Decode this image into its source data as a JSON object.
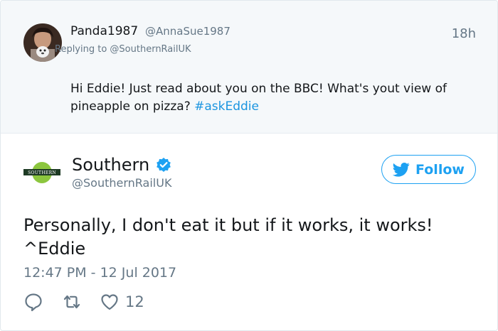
{
  "parent_tweet": {
    "display_name": "Panda1987",
    "handle": "@AnnaSue1987",
    "time_ago": "18h",
    "replying_to": "Replying to @SouthernRailUK",
    "text_main": "Hi Eddie! Just read about you on the BBC! What's yout view of pineapple on pizza? ",
    "hashtag": "#askEddie"
  },
  "tweet": {
    "display_name": "Southern",
    "handle": "@SouthernRailUK",
    "logo_text": "SOUTHERN",
    "follow_label": "Follow",
    "text": "Personally, I don't eat it but if it works, it works! ^Eddie",
    "timestamp": "12:47 PM - 12 Jul 2017",
    "likes": "12"
  },
  "colors": {
    "accent": "#1da1f2",
    "hashtag": "#1b95e0",
    "muted": "#657786",
    "parent_bg": "#f5f8fa",
    "southern_green": "#8cc63e",
    "southern_dark": "#1e3a24"
  },
  "icons": {
    "reply": "reply-icon",
    "retweet": "retweet-icon",
    "like": "heart-icon",
    "verified": "verified-badge-icon",
    "follow": "twitter-bird-icon"
  }
}
